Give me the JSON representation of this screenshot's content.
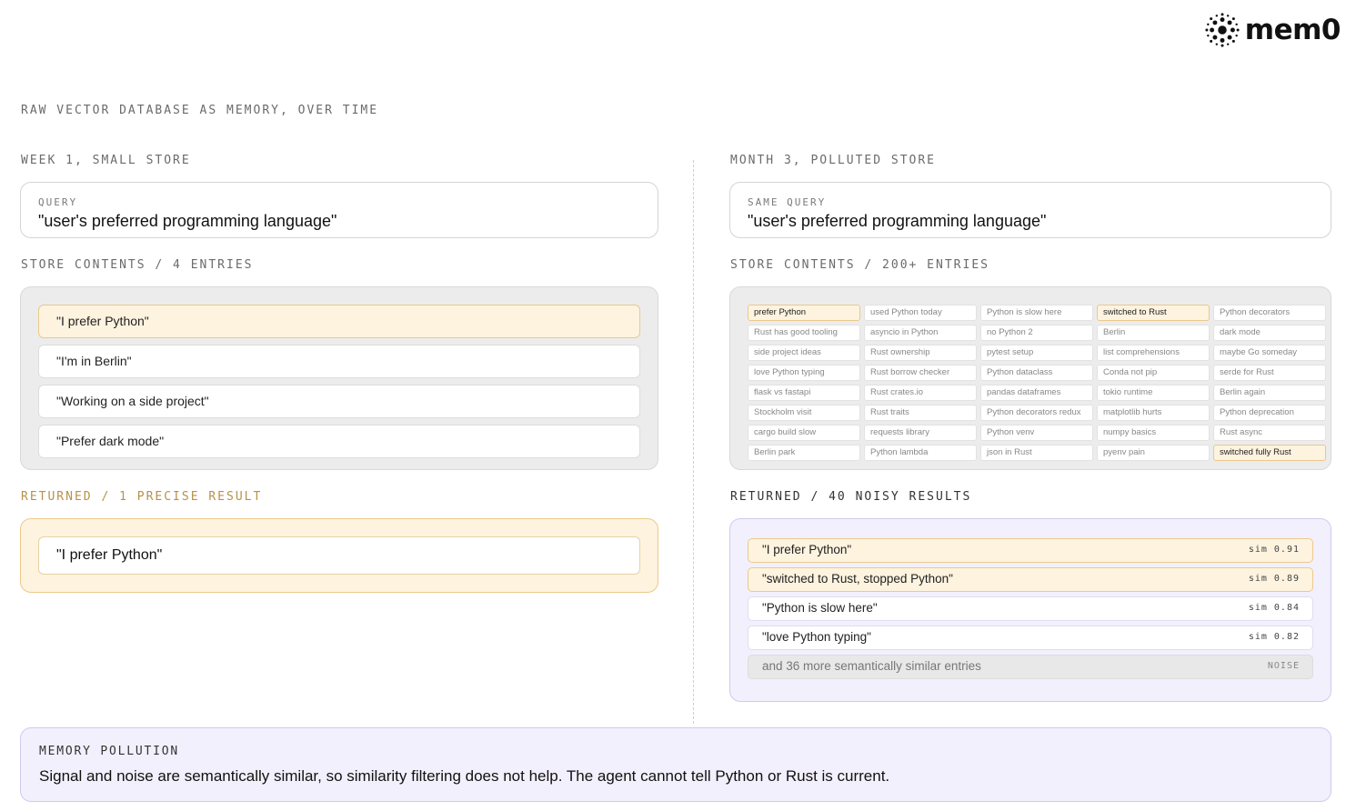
{
  "brand": {
    "name": "mem0",
    "icon": "mem0-logo-icon"
  },
  "title": "RAW VECTOR DATABASE AS MEMORY, OVER TIME",
  "left": {
    "heading": "WEEK 1, SMALL STORE",
    "query_label": "QUERY",
    "query_text": "\"user's preferred programming language\"",
    "store_label": "STORE CONTENTS / 4 ENTRIES",
    "store_items": [
      {
        "text": "\"I prefer Python\"",
        "highlighted": true
      },
      {
        "text": "\"I'm in Berlin\"",
        "highlighted": false
      },
      {
        "text": "\"Working on a side project\"",
        "highlighted": false
      },
      {
        "text": "\"Prefer dark mode\"",
        "highlighted": false
      }
    ],
    "returned_label": "RETURNED / 1 PRECISE RESULT",
    "returned_item": "\"I prefer Python\""
  },
  "right": {
    "heading": "MONTH 3, POLLUTED STORE",
    "query_label": "SAME QUERY",
    "query_text": "\"user's preferred programming language\"",
    "store_label": "STORE CONTENTS / 200+ ENTRIES",
    "grid": [
      [
        "prefer Python",
        "used Python today",
        "Python is slow here",
        "switched to Rust",
        "Python decorators"
      ],
      [
        "Rust has good tooling",
        "asyncio in Python",
        "no Python 2",
        "Berlin",
        "dark mode"
      ],
      [
        "side project ideas",
        "Rust ownership",
        "pytest setup",
        "list comprehensions",
        "maybe Go someday"
      ],
      [
        "love Python typing",
        "Rust borrow checker",
        "Python dataclass",
        "Conda not pip",
        "serde for Rust"
      ],
      [
        "flask vs fastapi",
        "Rust crates.io",
        "pandas dataframes",
        "tokio runtime",
        "Berlin again"
      ],
      [
        "Stockholm visit",
        "Rust traits",
        "Python decorators redux",
        "matplotlib hurts",
        "Python deprecation"
      ],
      [
        "cargo build slow",
        "requests library",
        "Python venv",
        "numpy basics",
        "Rust async"
      ],
      [
        "Berlin park",
        "Python lambda",
        "json in Rust",
        "pyenv pain",
        "switched fully Rust"
      ]
    ],
    "grid_highlighted": [
      "prefer Python",
      "switched to Rust",
      "switched fully Rust"
    ],
    "returned_label": "RETURNED / 40 NOISY RESULTS",
    "results": [
      {
        "text": "\"I prefer Python\"",
        "score": "sim 0.91",
        "kind": "hl"
      },
      {
        "text": "\"switched to Rust, stopped Python\"",
        "score": "sim 0.89",
        "kind": "hl"
      },
      {
        "text": "\"Python is slow here\"",
        "score": "sim 0.84",
        "kind": "plain"
      },
      {
        "text": "\"love Python typing\"",
        "score": "sim 0.82",
        "kind": "plain"
      },
      {
        "text": "and 36 more semantically similar entries",
        "score": "NOISE",
        "kind": "noise"
      }
    ]
  },
  "footer": {
    "label": "MEMORY POLLUTION",
    "text": "Signal and noise are semantically similar, so similarity filtering does not help. The agent cannot tell Python or Rust is current."
  },
  "colors": {
    "highlight_bg": "#fdf3df",
    "highlight_border": "#eac98c",
    "purple_bg": "#f3f0fd",
    "purple_border": "#d2c8ee",
    "gold_label": "#b8914a"
  }
}
